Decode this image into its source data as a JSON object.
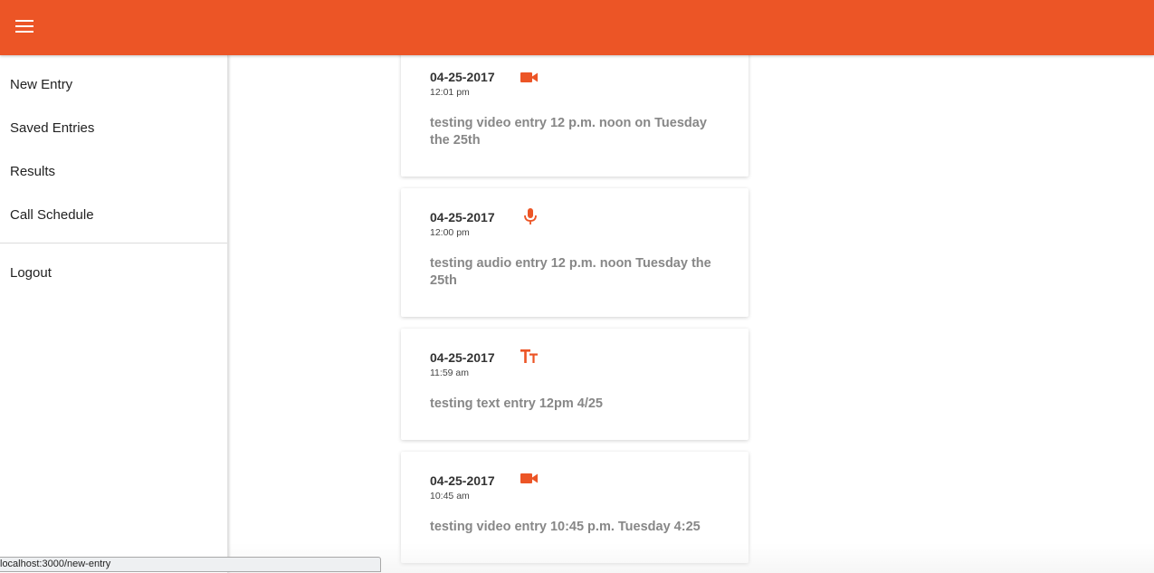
{
  "appbar": {
    "menu_icon": "hamburger-menu-icon",
    "color": "#ec5526"
  },
  "nav": {
    "items": [
      {
        "label": "New Entry"
      },
      {
        "label": "Saved Entries"
      },
      {
        "label": "Results"
      },
      {
        "label": "Call Schedule"
      }
    ],
    "logout_label": "Logout"
  },
  "entries": [
    {
      "date": "04-25-2017",
      "time": "12:01 pm",
      "type_icon": "video-camera-icon",
      "text": "testing video entry 12 p.m. noon on Tuesday the 25th"
    },
    {
      "date": "04-25-2017",
      "time": "12:00 pm",
      "type_icon": "microphone-icon",
      "text": "testing audio entry 12 p.m. noon Tuesday the 25th"
    },
    {
      "date": "04-25-2017",
      "time": "11:59 am",
      "type_icon": "text-size-icon",
      "text": "testing text entry 12pm 4/25"
    },
    {
      "date": "04-25-2017",
      "time": "10:45 am",
      "type_icon": "video-camera-icon",
      "text": "testing video entry 10:45 p.m. Tuesday 4:25"
    }
  ],
  "status_bar": {
    "url": "localhost:3000/new-entry"
  },
  "colors": {
    "accent": "#ec5526",
    "body_text": "#878787"
  }
}
